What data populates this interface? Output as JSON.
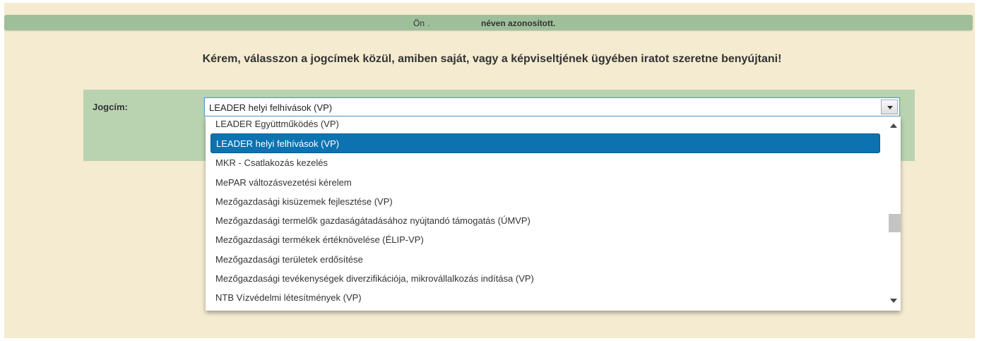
{
  "identity_bar": {
    "on_label": "Ön",
    "dot": ".",
    "message": "néven azonosított."
  },
  "instruction": "Kérem, válasszon a jogcímek közül, amiben saját, vagy a képviseltjének ügyében iratot szeretne benyújtani!",
  "jogcim": {
    "label": "Jogcím:",
    "selected_value": "LEADER helyi felhívások (VP)"
  },
  "dropdown": {
    "options": [
      "LEADER Együttműködés (VP)",
      "LEADER helyi felhívások (VP)",
      "MKR - Csatlakozás kezelés",
      "MePAR változásvezetési kérelem",
      "Mezőgazdasági kisüzemek fejlesztése (VP)",
      "Mezőgazdasági termelők gazdaságátadásához nyújtandó támogatás (ÚMVP)",
      "Mezőgazdasági termékek értéknövelése (ÉLIP-VP)",
      "Mezőgazdasági területek erdősítése",
      "Mezőgazdasági tevékenységek diverzifikációja, mikrovállalkozás indítása (VP)",
      "NTB Vízvédelmi létesítmények (VP)"
    ],
    "selected_index": 1
  },
  "colors": {
    "page_background": "#f4ebd0",
    "identity_bar": "#9fbf9a",
    "panel": "#b9d3b0",
    "selected_option": "#0d72b0"
  }
}
